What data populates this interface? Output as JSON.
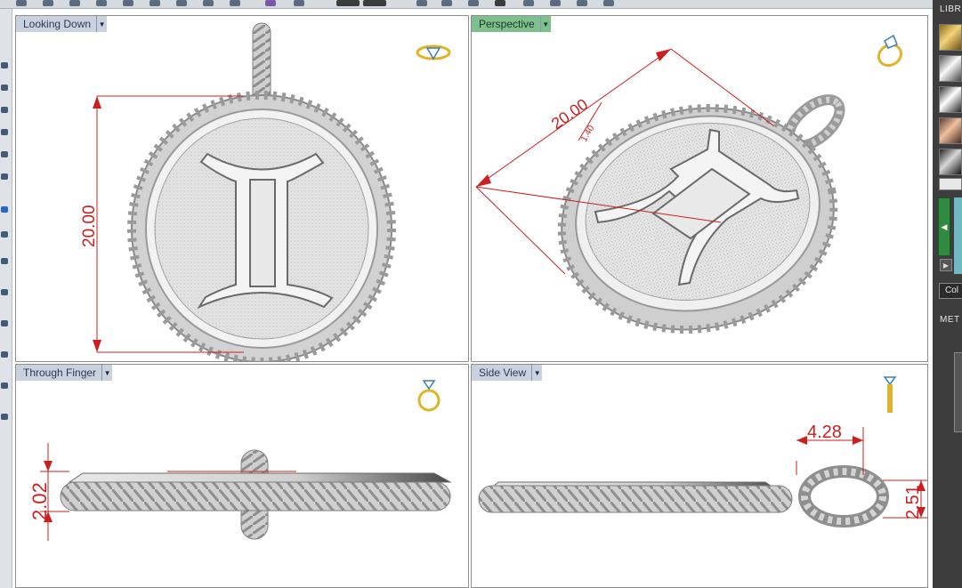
{
  "viewports": {
    "top": {
      "title": "Looking Down",
      "dim_label": "20.00"
    },
    "perspective": {
      "title": "Perspective",
      "dim_label": "20.00",
      "dim_label_small": "1.40"
    },
    "front": {
      "title": "Through Finger",
      "dim_label": "2.02"
    },
    "side": {
      "title": "Side View",
      "dim_label_width": "4.28",
      "dim_label_height": "2.51"
    }
  },
  "right_panel": {
    "library_label": "LIBR",
    "color_button": "Col",
    "metal_label": "MET"
  },
  "colors": {
    "dimension": "#cc1f1f",
    "active_viewport": "#7fbf8f",
    "inactive_viewport": "#c9d2de",
    "icon_gold": "#e0b42a"
  }
}
